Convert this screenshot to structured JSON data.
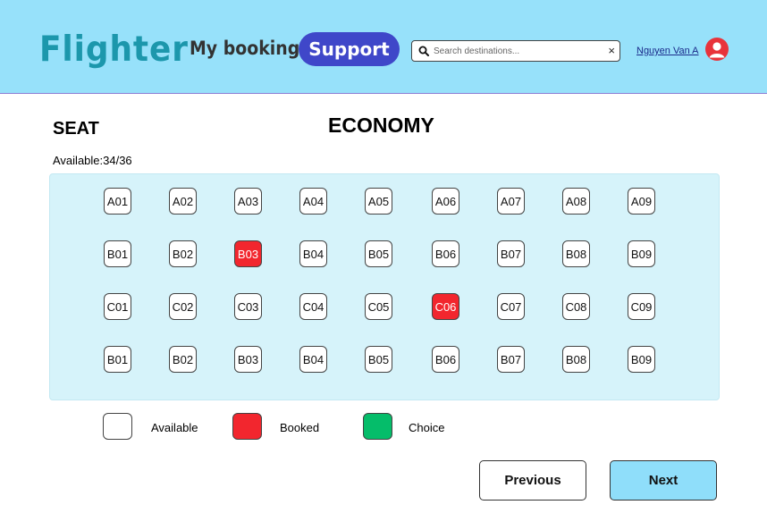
{
  "header": {
    "logo": "Flighter",
    "nav_booking": "My booking",
    "nav_support": "Support",
    "search_placeholder": "Search destinations...",
    "clear_symbol": "×",
    "user_name": "Nguyen Van A",
    "colors": {
      "header_bg": "#97e1fa",
      "logo": "#1c97ac",
      "support_bg": "#3f47c9",
      "avatar": "#e8333b"
    }
  },
  "main": {
    "seat_title": "SEAT",
    "class_title": "ECONOMY",
    "available": "Available:34/36"
  },
  "seat_rows": [
    [
      "A01",
      "A02",
      "A03",
      "A04",
      "A05",
      "A06",
      "A07",
      "A08",
      "A09"
    ],
    [
      "B01",
      "B02",
      "B03",
      "B04",
      "B05",
      "B06",
      "B07",
      "B08",
      "B09"
    ],
    [
      "C01",
      "C02",
      "C03",
      "C04",
      "C05",
      "C06",
      "C07",
      "C08",
      "C09"
    ],
    [
      "B01",
      "B02",
      "B03",
      "B04",
      "B05",
      "B06",
      "B07",
      "B08",
      "B09"
    ]
  ],
  "seat_states": [
    [
      "available",
      "available",
      "available",
      "available",
      "available",
      "available",
      "available",
      "available",
      "available"
    ],
    [
      "available",
      "available",
      "booked",
      "available",
      "available",
      "available",
      "available",
      "available",
      "available"
    ],
    [
      "available",
      "available",
      "available",
      "available",
      "available",
      "booked",
      "available",
      "available",
      "available"
    ],
    [
      "available",
      "available",
      "available",
      "available",
      "available",
      "available",
      "available",
      "available",
      "available"
    ]
  ],
  "legend": {
    "available": {
      "label": "Available",
      "color": "#ffffff"
    },
    "booked": {
      "label": "Booked",
      "color": "#f2262e"
    },
    "choice": {
      "label": "Choice",
      "color": "#05bd6a"
    }
  },
  "buttons": {
    "previous": "Previous",
    "next": "Next"
  }
}
